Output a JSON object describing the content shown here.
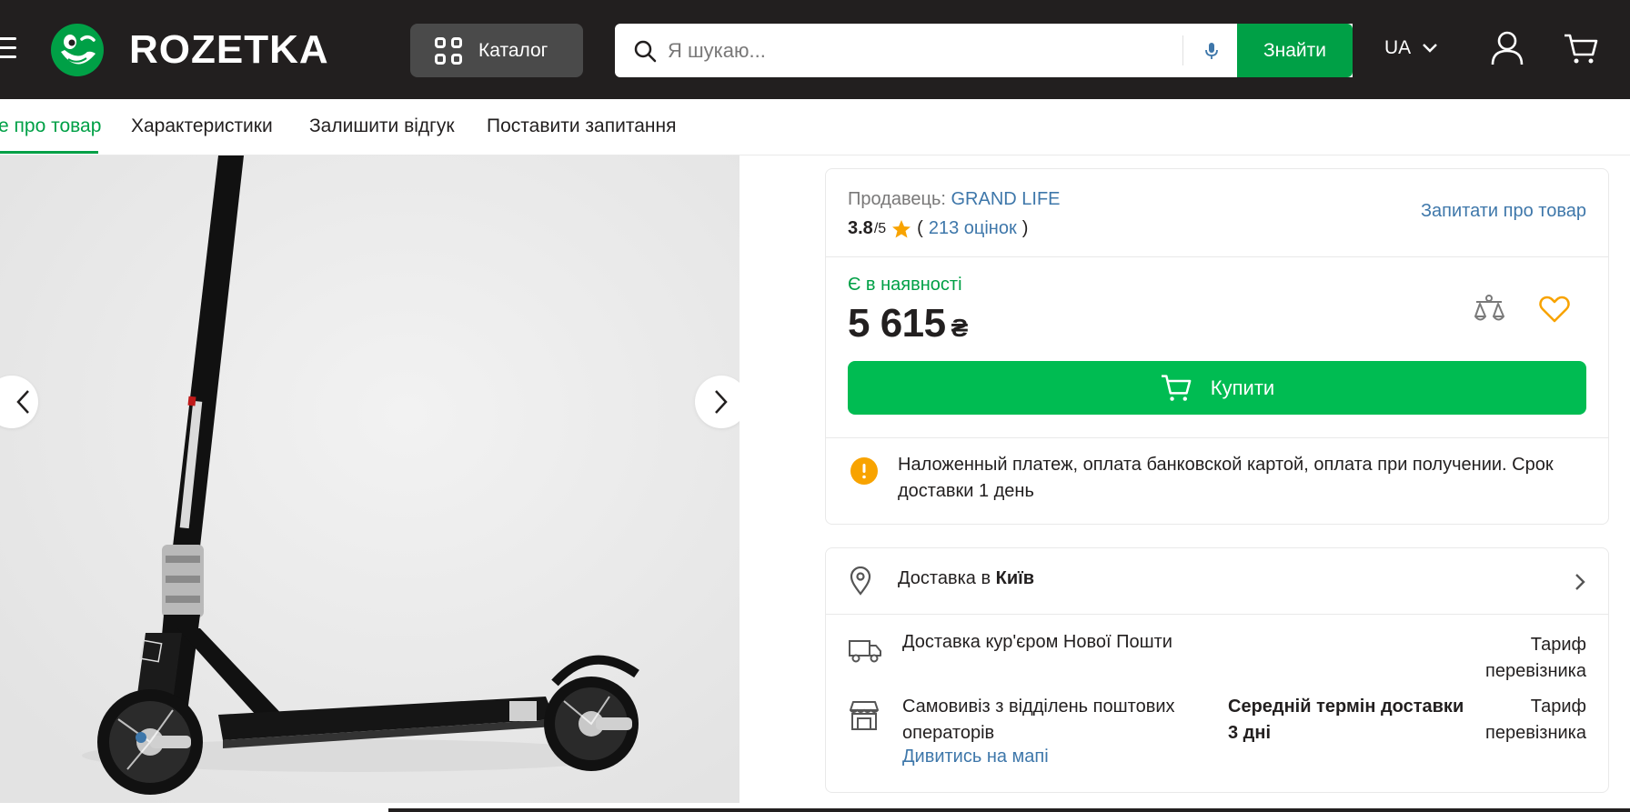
{
  "header": {
    "logo_text": "ROZETKA",
    "catalog_label": "Каталог",
    "search_placeholder": "Я шукаю...",
    "search_button": "Знайти",
    "lang": "UA"
  },
  "tabs": [
    {
      "label": "е про товар",
      "active": true
    },
    {
      "label": "Характеристики",
      "active": false
    },
    {
      "label": "Залишити відгук",
      "active": false
    },
    {
      "label": "Поставити запитання",
      "active": false
    }
  ],
  "seller": {
    "label": "Продавець:",
    "name": "GRAND LIFE",
    "rating": "3.8",
    "rating_max": "/5",
    "reviews_open": "(",
    "reviews": "213 оцінок",
    "reviews_close": ")",
    "ask_link": "Запитати про товар"
  },
  "product": {
    "stock": "Є в наявності",
    "price": "5 615",
    "currency": "₴",
    "buy_label": "Купити",
    "payment_info": "Наложенный платеж, оплата банковской картой, оплата при получении. Срок доставки 1 день"
  },
  "delivery": {
    "title_prefix": "Доставка в",
    "city": "Київ",
    "rows": [
      {
        "name": "Доставка кур'єром Нової Пошти",
        "tariff": "Тариф перевізника"
      },
      {
        "name": "Самовивіз з відділень поштових операторів",
        "term": "Середній термін доставки 3 дні",
        "tariff": "Тариф перевізника"
      }
    ],
    "map_link": "Дивитись на мапі"
  },
  "colors": {
    "header_bg": "#221f1f",
    "brand_green": "#00a046",
    "buy_green": "#00bc52",
    "link_blue": "#3e77aa",
    "warning": "#f8a300"
  }
}
